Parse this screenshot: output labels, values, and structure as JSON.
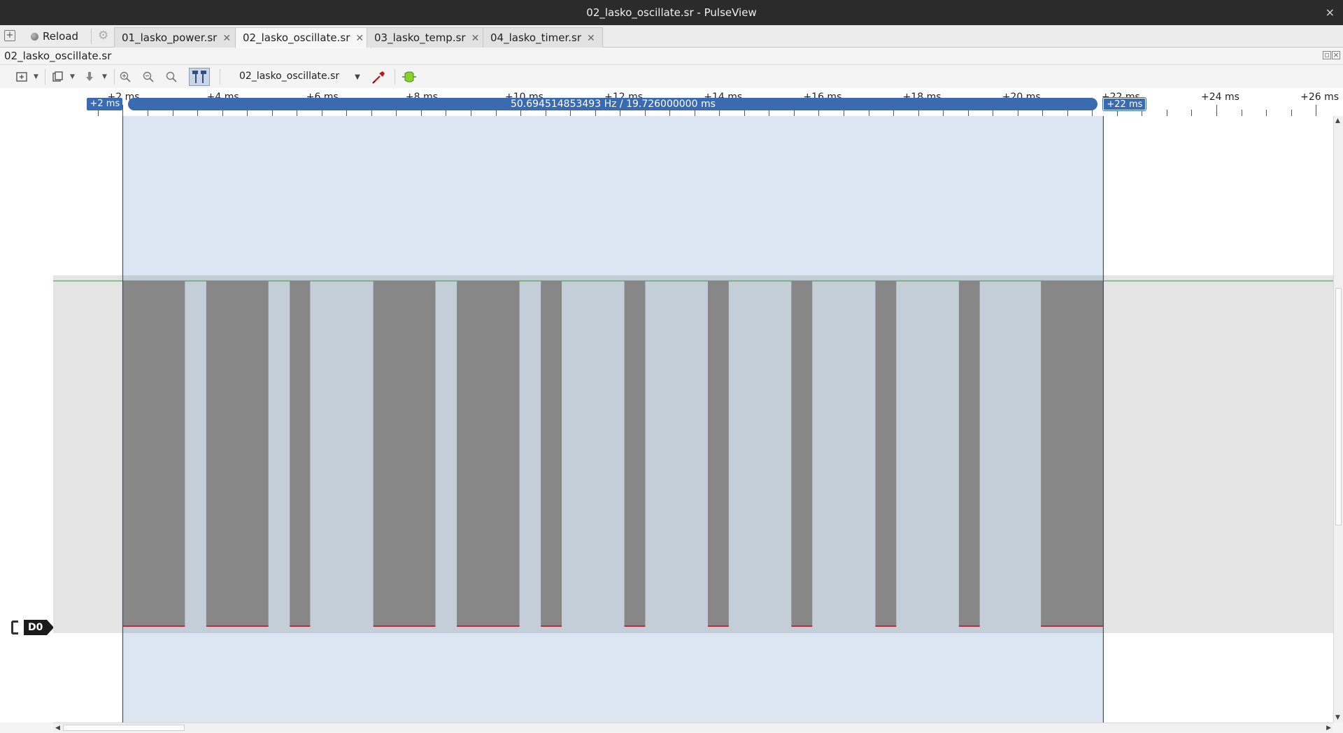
{
  "window": {
    "title": "02_lasko_oscillate.sr - PulseView",
    "close_glyph": "×"
  },
  "tabbar": {
    "new_session_glyph": "+",
    "reload_label": "Reload",
    "tabs": [
      {
        "label": "01_lasko_power.sr",
        "active": false
      },
      {
        "label": "02_lasko_oscillate.sr",
        "active": true
      },
      {
        "label": "03_lasko_temp.sr",
        "active": false
      },
      {
        "label": "04_lasko_timer.sr",
        "active": false
      }
    ],
    "tab_close_glyph": "✕"
  },
  "session": {
    "label": "02_lasko_oscillate.sr"
  },
  "toolbar": {
    "icons": [
      "add-view-icon",
      "open-file-icon",
      "save-icon",
      "zoom-in-icon",
      "zoom-out-icon",
      "zoom-fit-icon",
      "cursor-toggle-icon",
      "probe-icon",
      "trigger-decoder-icon"
    ],
    "device": "02_lasko_oscillate.sr"
  },
  "ruler": {
    "tick_labels": [
      "+2 ms",
      "+4 ms",
      "+6 ms",
      "+8 ms",
      "+10 ms",
      "+12 ms",
      "+14 ms",
      "+16 ms",
      "+18 ms",
      "+20 ms",
      "+22 ms",
      "+24 ms",
      "+26 ms"
    ],
    "cursor_left_label": "+2 ms",
    "cursor_right_label": "+22 ms",
    "measurement": "50.694514853493 Hz / 19.726000000 ms"
  },
  "trace": {
    "channel": "D0",
    "time_start_ms": 0.6,
    "time_end_ms": 26.35,
    "cursor_a_ms": 2.0,
    "cursor_b_ms": 21.726,
    "bursts_ms": [
      [
        2.0,
        3.25
      ],
      [
        3.68,
        4.93
      ],
      [
        5.36,
        5.77
      ],
      [
        7.04,
        8.29
      ],
      [
        8.72,
        9.98
      ],
      [
        10.41,
        10.83
      ],
      [
        12.09,
        12.51
      ],
      [
        13.77,
        14.19
      ],
      [
        15.45,
        15.87
      ],
      [
        17.14,
        17.56
      ],
      [
        18.82,
        19.24
      ],
      [
        20.47,
        21.726
      ]
    ],
    "colors": {
      "selection": "#dce6f2",
      "signal_band": "#e4e4e4",
      "signal_band_selected": "#c4ced9",
      "burst": "#878787",
      "cursor_line": "#34507a",
      "high_line": "#2f9e2f",
      "low_line": "#c8243a"
    }
  },
  "scrollbars": {
    "up": "▲",
    "down": "▼",
    "left": "◀",
    "right": "▶"
  }
}
